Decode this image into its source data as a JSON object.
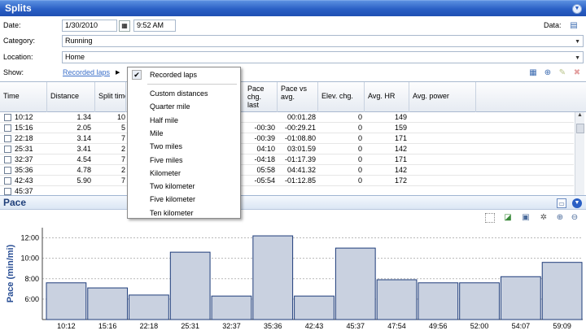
{
  "splits_header": {
    "title": "Splits"
  },
  "form": {
    "date_label": "Date:",
    "date_value": "1/30/2010",
    "time_value": "9:52 AM",
    "data_label": "Data:",
    "category_label": "Category:",
    "category_value": "Running",
    "location_label": "Location:",
    "location_value": "Home",
    "show_label": "Show:",
    "show_link": "Recorded laps"
  },
  "grid": {
    "headers": [
      "Time",
      "Distance",
      "Split time",
      "Pace chg. last",
      "Pace vs avg.",
      "Elev. chg.",
      "Avg. HR",
      "Avg. power"
    ],
    "rows": [
      {
        "time": "10:12",
        "distance": "1.34",
        "split": "10",
        "pchg": "",
        "pavg": "00:01.28",
        "elev": "0",
        "hr": "149"
      },
      {
        "time": "15:16",
        "distance": "2.05",
        "split": "5",
        "pchg": "-00:30",
        "pavg": "-00:29.21",
        "elev": "0",
        "hr": "159"
      },
      {
        "time": "22:18",
        "distance": "3.14",
        "split": "7",
        "pchg": "-00:39",
        "pavg": "-01:08.80",
        "elev": "0",
        "hr": "171"
      },
      {
        "time": "25:31",
        "distance": "3.41",
        "split": "2",
        "pchg": "04:10",
        "pavg": "03:01.59",
        "elev": "0",
        "hr": "142"
      },
      {
        "time": "32:37",
        "distance": "4.54",
        "split": "7",
        "pchg": "-04:18",
        "pavg": "-01:17.39",
        "elev": "0",
        "hr": "171"
      },
      {
        "time": "35:36",
        "distance": "4.78",
        "split": "2",
        "pchg": "05:58",
        "pavg": "04:41.32",
        "elev": "0",
        "hr": "142"
      },
      {
        "time": "42:43",
        "distance": "5.90",
        "split": "7",
        "pchg": "-05:54",
        "pavg": "-01:12.85",
        "elev": "0",
        "hr": "172"
      },
      {
        "time": "45:37",
        "distance": "",
        "split": "",
        "pchg": "",
        "pavg": "",
        "elev": "",
        "hr": ""
      }
    ]
  },
  "menu": {
    "items": [
      "Recorded laps",
      "Custom distances",
      "Quarter mile",
      "Half mile",
      "Mile",
      "Two miles",
      "Five miles",
      "Kilometer",
      "Two kilometer",
      "Five kilometer",
      "Ten kilometer"
    ],
    "checked": "Recorded laps"
  },
  "pace_panel": {
    "title": "Pace"
  },
  "chart_data": {
    "type": "bar",
    "ylabel": "Pace (min/mi)",
    "ylim": [
      4,
      13
    ],
    "yticks": [
      "6:00",
      "8:00",
      "10:00",
      "12:00"
    ],
    "ytick_values": [
      6,
      8,
      10,
      12
    ],
    "grid": true,
    "categories": [
      "10:12",
      "15:16",
      "22:18",
      "25:31",
      "32:37",
      "35:36",
      "42:43",
      "45:37",
      "47:54",
      "49:56",
      "52:00",
      "54:07",
      "59:09"
    ],
    "values": [
      7.6,
      7.1,
      6.4,
      10.6,
      6.3,
      12.2,
      6.3,
      11.0,
      7.9,
      7.6,
      7.6,
      8.2,
      9.6
    ],
    "bar_color": "#c9d1e0",
    "bar_stroke": "#1e3c7a"
  }
}
